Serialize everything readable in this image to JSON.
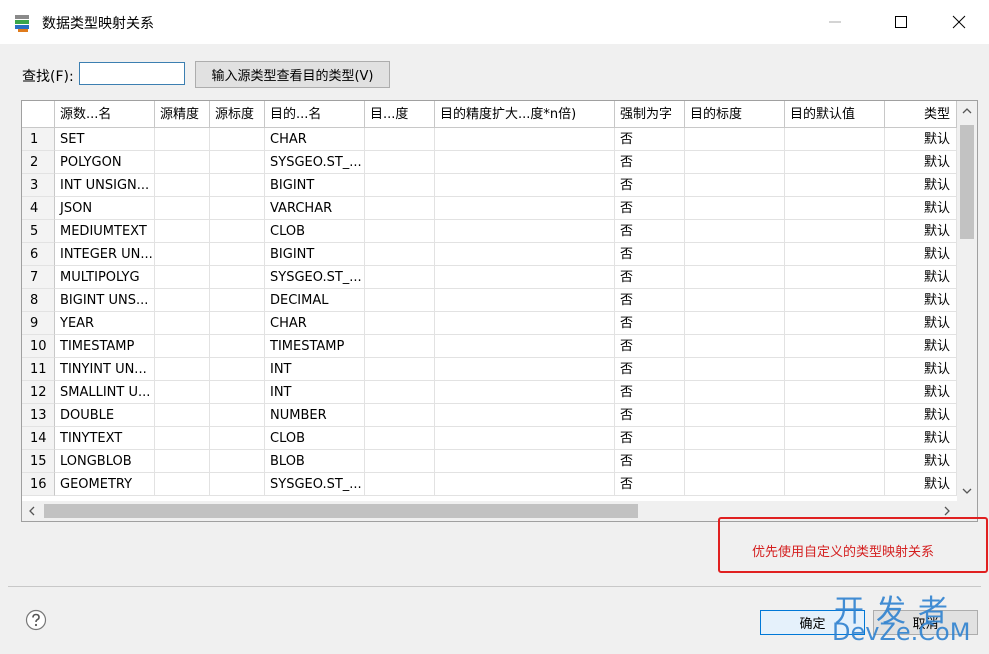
{
  "window": {
    "title": "数据类型映射关系"
  },
  "find": {
    "label": "查找(F):",
    "value": "",
    "button": "输入源类型查看目的类型(V)"
  },
  "table": {
    "columns": [
      "",
      "源数...名",
      "源精度",
      "源标度",
      "目的...名",
      "目...度",
      "目的精度扩大...度*n倍)",
      "强制为字",
      "目的标度",
      "目的默认值",
      "类型"
    ],
    "rows": [
      [
        "1",
        "SET",
        "",
        "",
        "CHAR",
        "",
        "",
        "否",
        "",
        "",
        "默认"
      ],
      [
        "2",
        "POLYGON",
        "",
        "",
        "SYSGEO.ST_...",
        "",
        "",
        "否",
        "",
        "",
        "默认"
      ],
      [
        "3",
        "INT UNSIGN...",
        "",
        "",
        "BIGINT",
        "",
        "",
        "否",
        "",
        "",
        "默认"
      ],
      [
        "4",
        "JSON",
        "",
        "",
        "VARCHAR",
        "",
        "",
        "否",
        "",
        "",
        "默认"
      ],
      [
        "5",
        "MEDIUMTEXT",
        "",
        "",
        "CLOB",
        "",
        "",
        "否",
        "",
        "",
        "默认"
      ],
      [
        "6",
        "INTEGER UN...",
        "",
        "",
        "BIGINT",
        "",
        "",
        "否",
        "",
        "",
        "默认"
      ],
      [
        "7",
        "MULTIPOLYG",
        "",
        "",
        "SYSGEO.ST_...",
        "",
        "",
        "否",
        "",
        "",
        "默认"
      ],
      [
        "8",
        "BIGINT UNS...",
        "",
        "",
        "DECIMAL",
        "",
        "",
        "否",
        "",
        "",
        "默认"
      ],
      [
        "9",
        "YEAR",
        "",
        "",
        "CHAR",
        "",
        "",
        "否",
        "",
        "",
        "默认"
      ],
      [
        "10",
        "TIMESTAMP",
        "",
        "",
        "TIMESTAMP",
        "",
        "",
        "否",
        "",
        "",
        "默认"
      ],
      [
        "11",
        "TINYINT UN...",
        "",
        "",
        "INT",
        "",
        "",
        "否",
        "",
        "",
        "默认"
      ],
      [
        "12",
        "SMALLINT U...",
        "",
        "",
        "INT",
        "",
        "",
        "否",
        "",
        "",
        "默认"
      ],
      [
        "13",
        "DOUBLE",
        "",
        "",
        "NUMBER",
        "",
        "",
        "否",
        "",
        "",
        "默认"
      ],
      [
        "14",
        "TINYTEXT",
        "",
        "",
        "CLOB",
        "",
        "",
        "否",
        "",
        "",
        "默认"
      ],
      [
        "15",
        "LONGBLOB",
        "",
        "",
        "BLOB",
        "",
        "",
        "否",
        "",
        "",
        "默认"
      ],
      [
        "16",
        "GEOMETRY",
        "",
        "",
        "SYSGEO.ST_...",
        "",
        "",
        "否",
        "",
        "",
        "默认"
      ]
    ]
  },
  "annotation": {
    "text": "优先使用自定义的类型映射关系"
  },
  "buttons": {
    "ok": "确定",
    "cancel": "取消"
  },
  "watermark": {
    "top": "开发者",
    "bottom": "DevZe.CoM"
  },
  "icons": {
    "app": "table-map-icon",
    "help": "help-icon",
    "minimize": "minimize-icon",
    "maximize": "maximize-icon",
    "close": "close-icon"
  },
  "colors": {
    "annotation": "#d42020",
    "watermark": "#2f82d0",
    "accent": "#0078d7"
  }
}
